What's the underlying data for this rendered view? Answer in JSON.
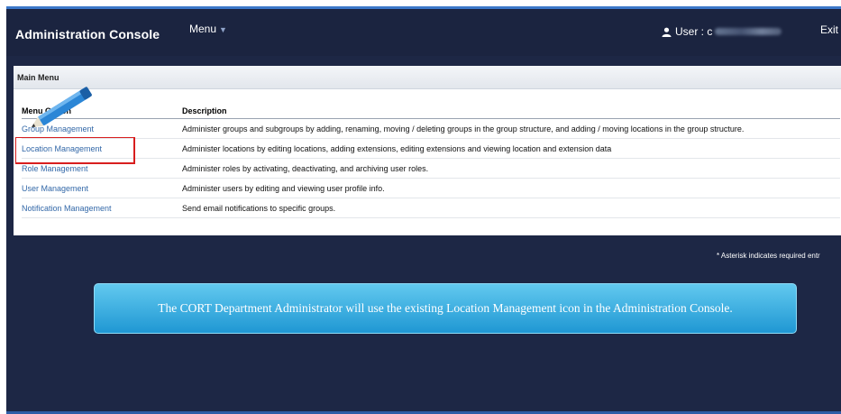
{
  "header": {
    "title": "Administration Console",
    "menu_label": "Menu",
    "user_label": "User : c",
    "exit_label": "Exit"
  },
  "main_menu": {
    "heading": "Main Menu",
    "columns": [
      "Menu Option",
      "Description"
    ],
    "rows": [
      {
        "name": "Group Management",
        "description": "Administer groups and subgroups by adding, renaming, moving / deleting groups in the group structure, and adding / moving locations in the group structure."
      },
      {
        "name": "Location Management",
        "description": "Administer locations by editing locations, adding extensions, editing extensions and viewing location and extension data"
      },
      {
        "name": "Role Management",
        "description": "Administer roles by activating, deactivating, and archiving user roles."
      },
      {
        "name": "User Management",
        "description": "Administer users by editing and viewing user profile info."
      },
      {
        "name": "Notification Management",
        "description": "Send email notifications to specific groups."
      }
    ]
  },
  "required_note": "* Asterisk indicates required entr",
  "callout_text": "The CORT Department Administrator will use the existing Location Management icon in the Administration Console.",
  "colors": {
    "background": "#1d2745",
    "link": "#3368a8",
    "highlight": "#d81e1e",
    "callout": "#1f97d3"
  }
}
